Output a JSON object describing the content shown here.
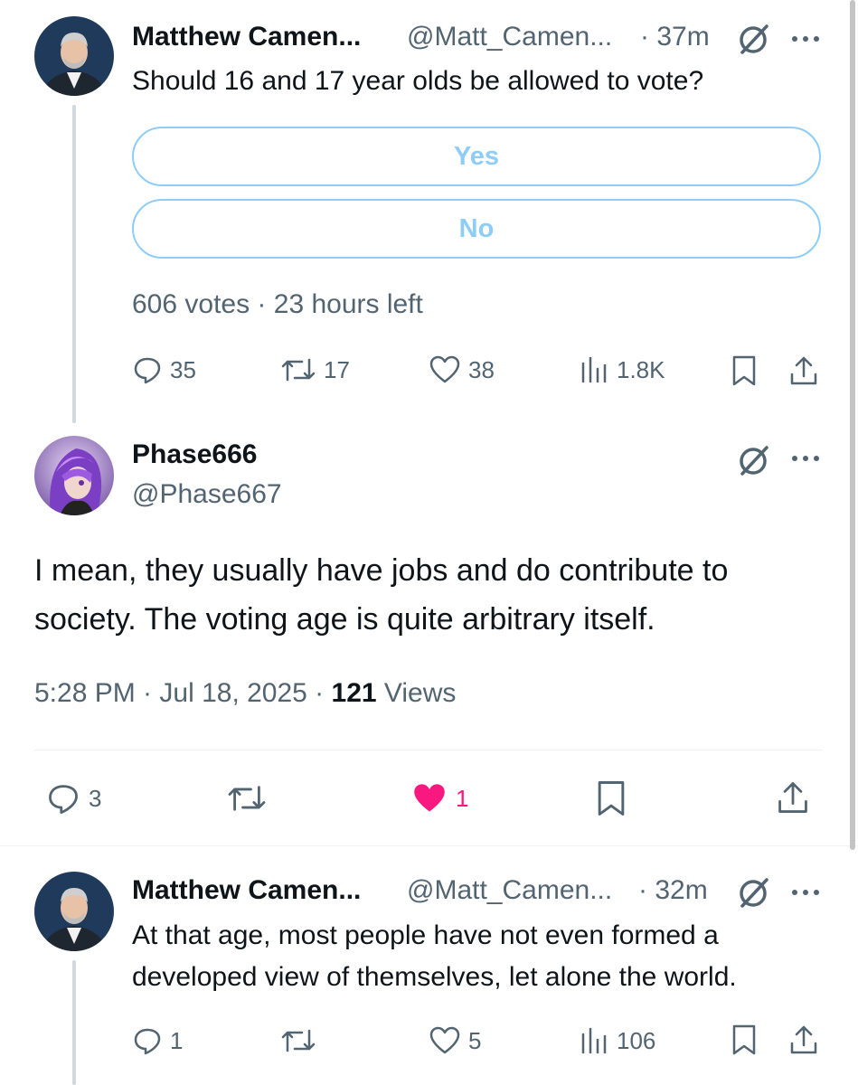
{
  "tweet1": {
    "name": "Matthew Camen...",
    "handle": "@Matt_Camen...",
    "time": "· 37m",
    "text": "Should 16 and 17 year olds be allowed to vote?",
    "poll": {
      "options": [
        "Yes",
        "No"
      ],
      "summary": "606 votes · 23 hours left"
    },
    "actions": {
      "replies": "35",
      "reposts": "17",
      "likes": "38",
      "views": "1.8K"
    }
  },
  "tweet2": {
    "name": "Phase666",
    "handle": "@Phase667",
    "text": "I mean, they usually have jobs and do contribute to society. The voting age is quite arbitrary itself.",
    "timestamp": "5:28 PM · Jul 18, 2025 · ",
    "views_count": "121",
    "views_label": " Views",
    "actions": {
      "replies": "3",
      "likes": "1"
    }
  },
  "tweet3": {
    "name": "Matthew Camen...",
    "handle": "@Matt_Camen...",
    "time": "· 32m",
    "text": "At that age, most people have not even formed a developed view of themselves, let alone the world.",
    "actions": {
      "replies": "1",
      "likes": "5",
      "views": "106"
    }
  },
  "icons": {
    "badge": "grok-slash-icon",
    "more": "more-dots-icon",
    "reply": "reply-icon",
    "repost": "repost-icon",
    "like": "heart-icon",
    "views": "views-bars-icon",
    "bookmark": "bookmark-icon",
    "share": "share-icon"
  },
  "colors": {
    "accent": "#1d9bf0",
    "poll_border": "#8ecdf8",
    "like_active": "#f91880",
    "secondary_text": "#536471"
  }
}
